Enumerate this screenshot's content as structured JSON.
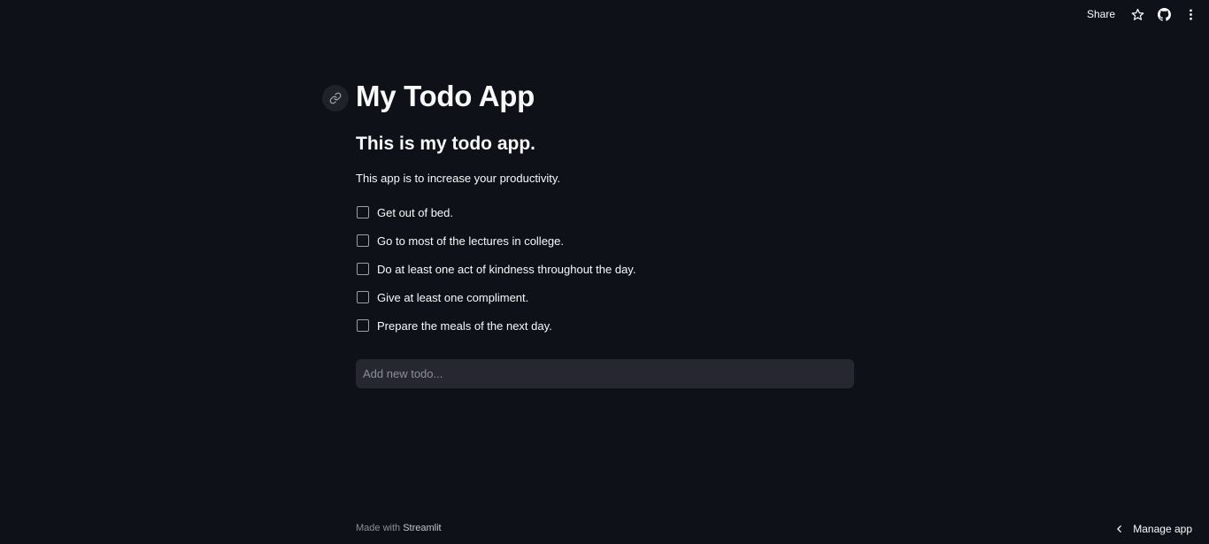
{
  "toolbar": {
    "share_label": "Share",
    "icons": [
      "star-icon",
      "github-icon",
      "more-vertical-icon"
    ]
  },
  "main": {
    "title": "My Todo App",
    "subtitle": "This is my todo app.",
    "description": "This app is to increase your productivity.",
    "todos": [
      {
        "label": "Get out of bed.",
        "checked": false
      },
      {
        "label": "Go to most of the lectures in college.",
        "checked": false
      },
      {
        "label": "Do at least one act of kindness throughout the day.",
        "checked": false
      },
      {
        "label": "Give at least one compliment.",
        "checked": false
      },
      {
        "label": "Prepare the meals of the next day.",
        "checked": false
      }
    ],
    "new_todo": {
      "value": "",
      "placeholder": "Add new todo..."
    }
  },
  "footer": {
    "made_with": "Made with",
    "brand": "Streamlit"
  },
  "manage_app": {
    "label": "Manage app"
  },
  "colors": {
    "background": "#0e1117",
    "text": "#fafafa",
    "input_background": "#262730",
    "muted": "#8b8f98"
  }
}
